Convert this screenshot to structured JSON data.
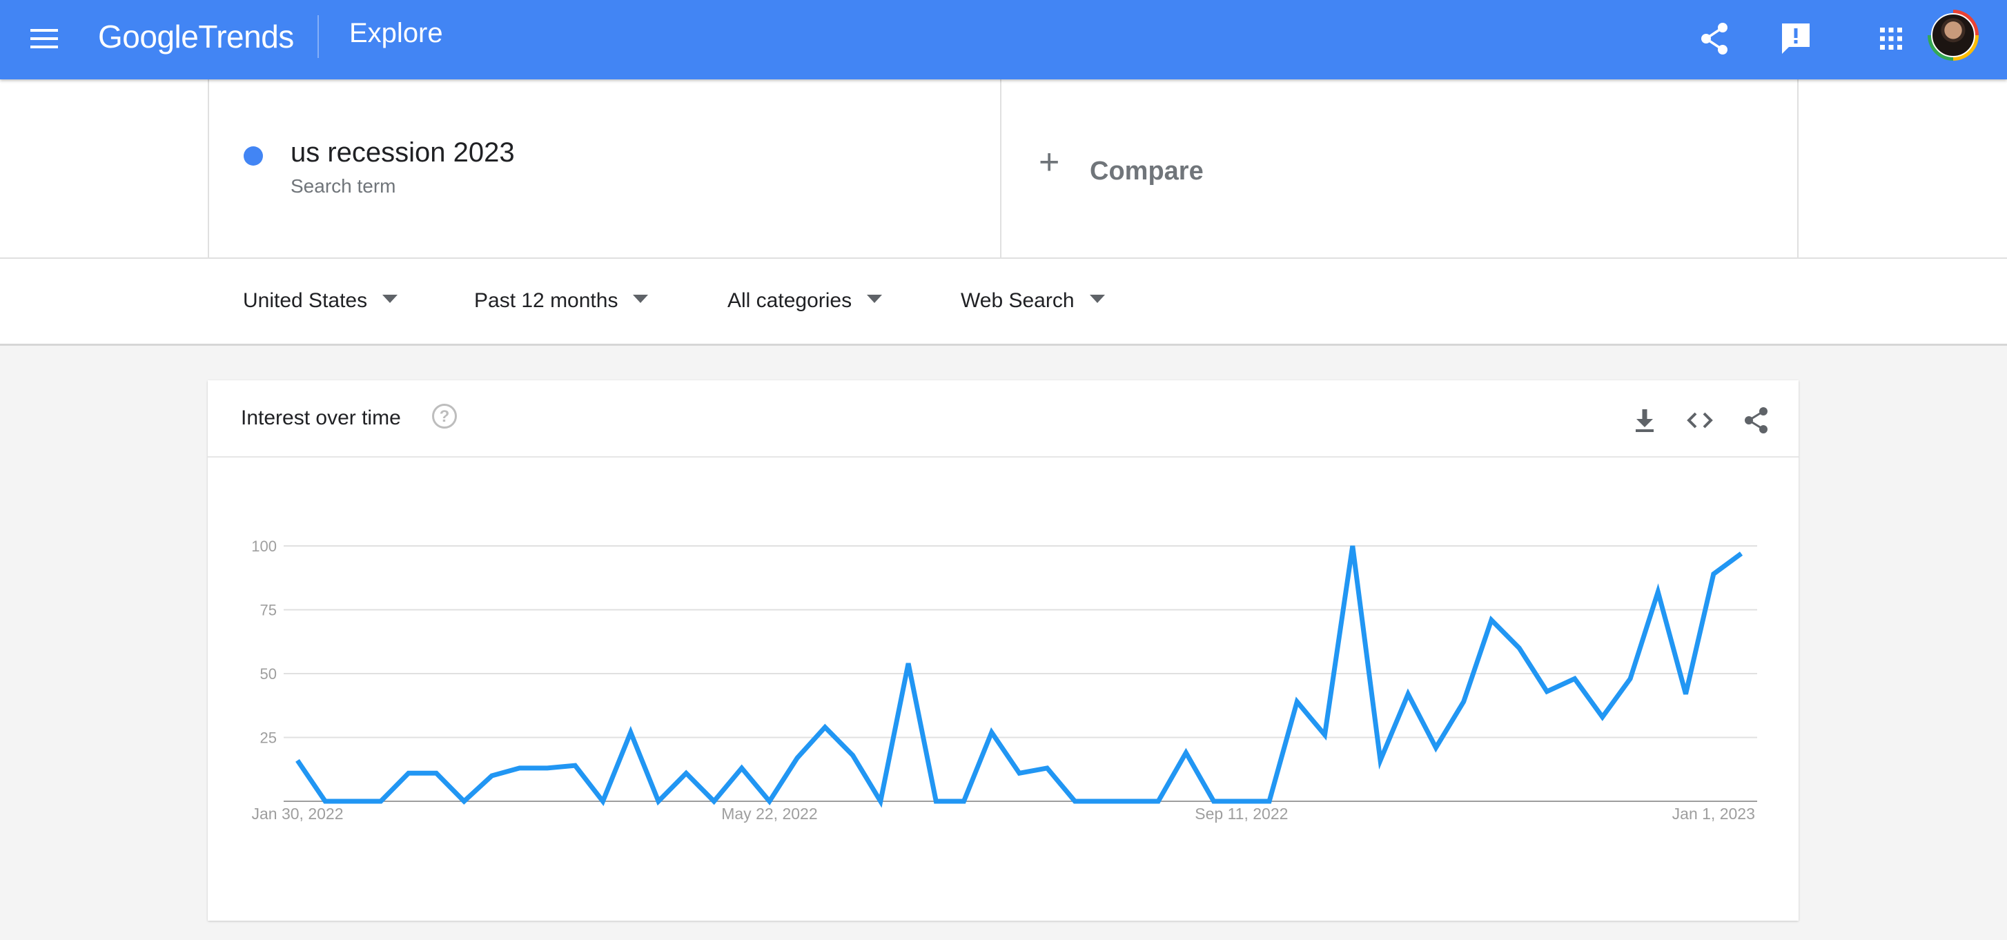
{
  "header": {
    "logo_google": "Google",
    "logo_trends": "Trends",
    "title": "Explore",
    "icons": [
      "menu-icon",
      "share-icon",
      "feedback-icon",
      "apps-grid-icon",
      "account-avatar"
    ],
    "bg_color": "#4285f4"
  },
  "search": {
    "term": "us recession 2023",
    "term_type": "Search term",
    "term_color": "#4285f4",
    "compare_label": "Compare"
  },
  "filters": {
    "region": "United States",
    "time": "Past 12 months",
    "category": "All categories",
    "property": "Web Search"
  },
  "card": {
    "title": "Interest over time",
    "help_icon": "?"
  },
  "chart_data": {
    "type": "line",
    "title": "Interest over time",
    "x_tick_labels": [
      "Jan 30, 2022",
      "May 22, 2022",
      "Sep 11, 2022",
      "Jan 1, 2023"
    ],
    "y_ticks": [
      25,
      50,
      75,
      100
    ],
    "ylim": [
      0,
      100
    ],
    "grid": true,
    "series": [
      {
        "color": "#2196f3",
        "values": [
          16,
          0,
          0,
          0,
          11,
          11,
          0,
          10,
          13,
          13,
          14,
          0,
          27,
          0,
          11,
          0,
          13,
          0,
          17,
          29,
          18,
          0,
          54,
          0,
          0,
          27,
          11,
          13,
          0,
          0,
          0,
          0,
          19,
          0,
          0,
          0,
          39,
          26,
          100,
          16,
          42,
          21,
          39,
          71,
          60,
          43,
          48,
          33,
          48,
          82,
          42,
          89,
          97
        ]
      }
    ]
  }
}
